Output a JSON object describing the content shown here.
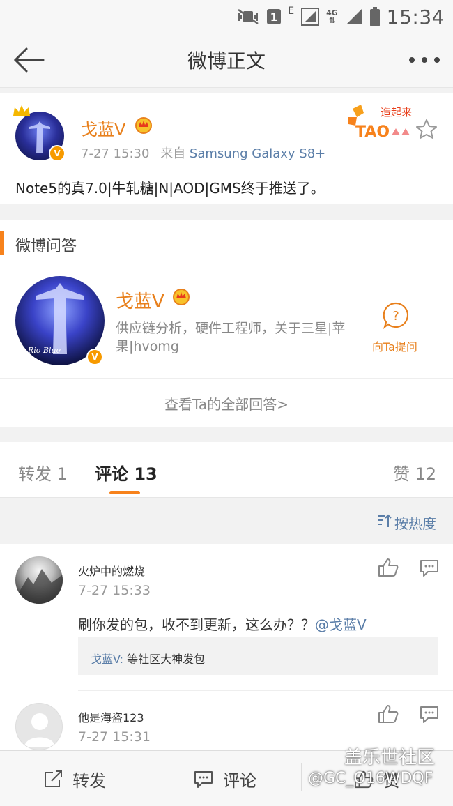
{
  "status_bar": {
    "sim_slot": "1",
    "network_e": "E",
    "network_4g": "4G",
    "time": "15:34"
  },
  "nav": {
    "title": "微博正文"
  },
  "post": {
    "author": "戈蓝V",
    "time": "7-27 15:30",
    "source_prefix": "来自",
    "source": "Samsung Galaxy S8+",
    "text": "Note5的真7.0|牛轧糖|N|AOD|GMS终于推送了。",
    "badge_letter": "V",
    "promo_text": "造起来",
    "promo_logo": "TAO"
  },
  "qa": {
    "section_title": "微博问答",
    "name": "戈蓝V",
    "description": "供应链分析，硬件工程师，关于三星|苹果|hvomg",
    "avatar_caption": "Rio Blue",
    "ask_label": "向Ta提问",
    "view_all": "查看Ta的全部回答>"
  },
  "tabs": {
    "repost": "转发 1",
    "comment": "评论 13",
    "like": "赞 12"
  },
  "sort": {
    "label": "按热度"
  },
  "comments": [
    {
      "name": "火炉中的燃烧",
      "time": "7-27 15:33",
      "text_main": "刷你发的包，收不到更新，这么办？？",
      "mention": "@戈蓝V",
      "reply_name": "戈蓝V:",
      "reply_text": " 等社区大神发包"
    },
    {
      "name": "他是海盗123",
      "time": "7-27 15:31"
    }
  ],
  "bottom_bar": {
    "repost": "转发",
    "comment": "评论",
    "like": "赞"
  },
  "watermark": {
    "brand": "盖乐世社区",
    "user": "@GC_O16WDQF"
  },
  "colors": {
    "accent_orange": "#f7821c",
    "name_orange": "#e8801c",
    "link_blue": "#5b7ea8"
  }
}
